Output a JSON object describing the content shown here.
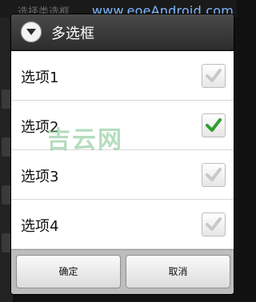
{
  "background": {
    "watermark": "www.eoeAndroid.com",
    "faint_text": "选择类选框"
  },
  "dialog": {
    "title": "多选框",
    "title_icon": "chevron-down-circle-icon",
    "options": [
      {
        "label": "选项1",
        "checked": false
      },
      {
        "label": "选项2",
        "checked": true
      },
      {
        "label": "选项3",
        "checked": false
      },
      {
        "label": "选项4",
        "checked": false
      }
    ],
    "ok_label": "确定",
    "cancel_label": "取消"
  },
  "overlay_watermark": "吉云网",
  "colors": {
    "title_bar": "#3a3a3a",
    "check_on": "#2f9e2f",
    "check_off": "#c8c8c8"
  }
}
